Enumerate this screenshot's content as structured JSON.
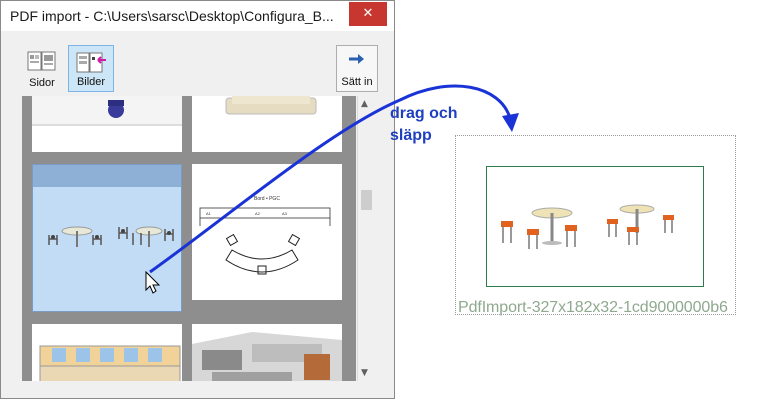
{
  "window": {
    "title": "PDF import - C:\\Users\\sarsc\\Desktop\\Configura_B...",
    "close_symbol": "✕"
  },
  "toolbar": {
    "pages_label": "Sidor",
    "images_label": "Bilder",
    "insert_label": "Sätt in"
  },
  "annotation": {
    "line1": "drag och",
    "line2": "släpp"
  },
  "drop": {
    "filename": "PdfImport-327x182x32-1cd9000000b6"
  },
  "thumbnail_text": {
    "plan_title": "Bord • PGC",
    "plan_a1": "A1",
    "plan_a2": "A2",
    "plan_a3": "A3"
  },
  "scrollbar": {
    "up": "▲",
    "down": "▼"
  },
  "colors": {
    "annotation": "#1f3fbf",
    "selected_thumb": "#c2dcf5",
    "drop_border": "#2f7a4a",
    "close_button": "#c7372f"
  },
  "icons": [
    "pages-icon",
    "images-icon",
    "insert-arrow-icon",
    "mouse-cursor-icon",
    "drag-arrow-icon"
  ]
}
